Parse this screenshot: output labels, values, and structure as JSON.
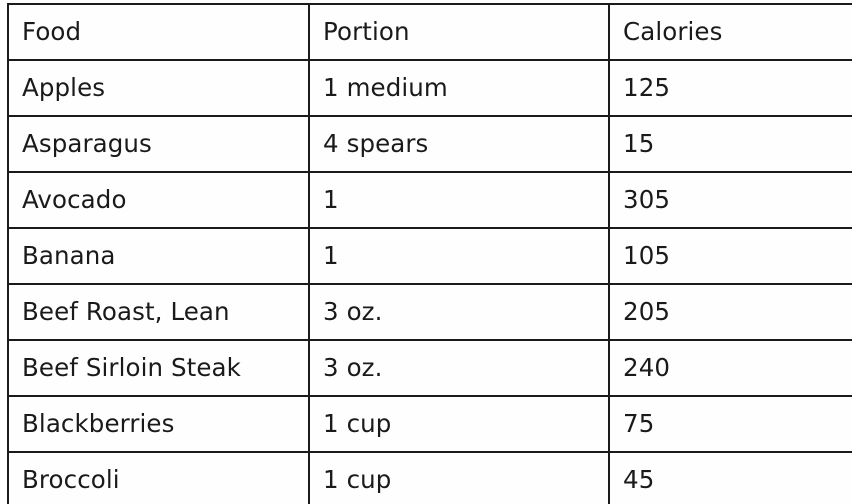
{
  "document": {
    "type": "data-table",
    "background_color": "#fefefe",
    "border_color": "#1b1b1b",
    "text_color": "#1a1a1a"
  },
  "table": {
    "columns": [
      {
        "key": "food",
        "label": "Food"
      },
      {
        "key": "portion",
        "label": "Portion"
      },
      {
        "key": "calories",
        "label": "Calories"
      }
    ],
    "rows": [
      {
        "food": "Apples",
        "portion": "1 medium",
        "calories": "125"
      },
      {
        "food": "Asparagus",
        "portion": "4 spears",
        "calories": "15"
      },
      {
        "food": "Avocado",
        "portion": "1",
        "calories": "305"
      },
      {
        "food": "Banana",
        "portion": "1",
        "calories": "105"
      },
      {
        "food": "Beef Roast, Lean",
        "portion": "3 oz.",
        "calories": "205"
      },
      {
        "food": "Beef Sirloin Steak",
        "portion": "3 oz.",
        "calories": "240"
      },
      {
        "food": "Blackberries",
        "portion": "1 cup",
        "calories": "75"
      },
      {
        "food": "Broccoli",
        "portion": "1 cup",
        "calories": "45"
      }
    ]
  }
}
